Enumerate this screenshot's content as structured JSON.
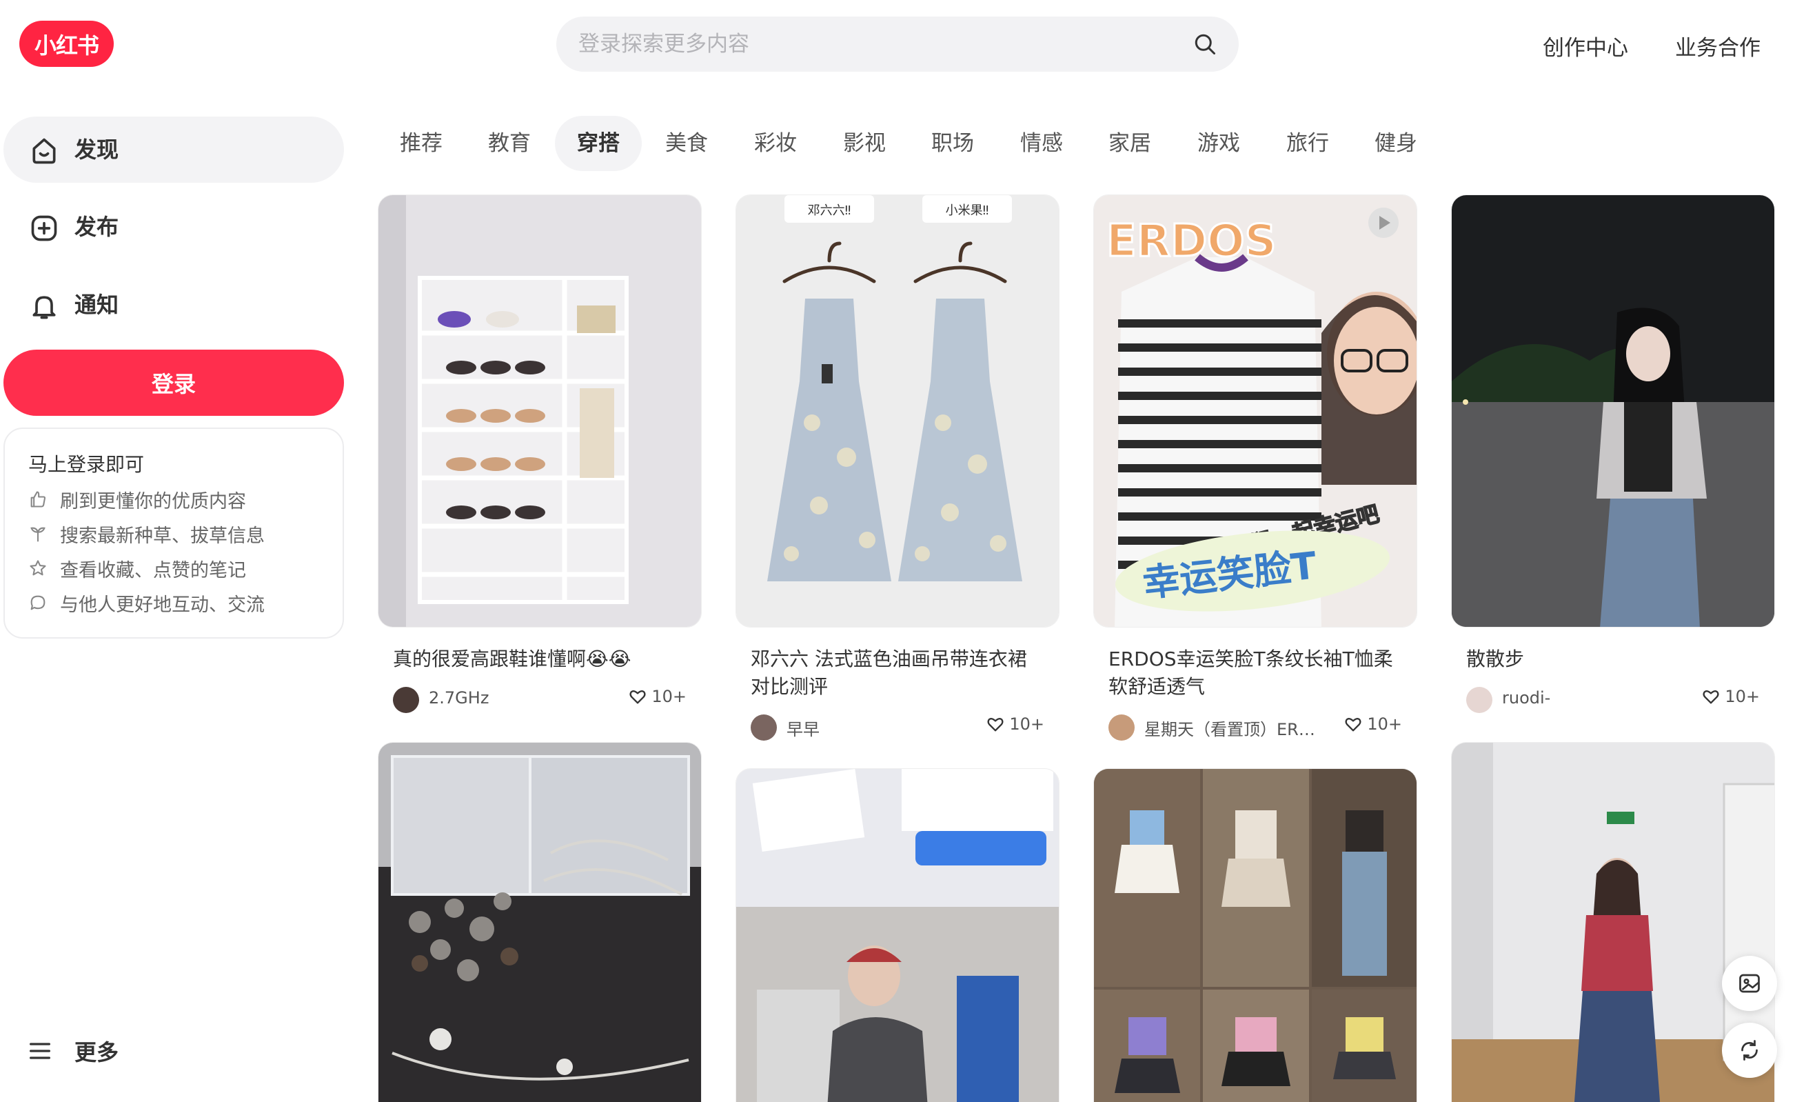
{
  "header": {
    "logo_text": "小红书",
    "search_placeholder": "登录探索更多内容",
    "links": [
      "创作中心",
      "业务合作"
    ]
  },
  "sidebar": {
    "nav": [
      {
        "label": "发现",
        "icon": "discover-icon",
        "active": true
      },
      {
        "label": "发布",
        "icon": "plus-square-icon",
        "active": false
      },
      {
        "label": "通知",
        "icon": "bell-icon",
        "active": false
      }
    ],
    "login_button": "登录",
    "login_card": {
      "title": "马上登录即可",
      "perks": [
        {
          "icon": "thumbs-up-icon",
          "text": "刷到更懂你的优质内容"
        },
        {
          "icon": "grass-icon",
          "text": "搜索最新种草、拔草信息"
        },
        {
          "icon": "star-icon",
          "text": "查看收藏、点赞的笔记"
        },
        {
          "icon": "chat-bubble-icon",
          "text": "与他人更好地互动、交流"
        }
      ]
    },
    "more": "更多"
  },
  "channels": [
    "推荐",
    "教育",
    "穿搭",
    "美食",
    "彩妆",
    "影视",
    "职场",
    "情感",
    "家居",
    "游戏",
    "旅行",
    "健身"
  ],
  "active_channel": "穿搭",
  "feed": [
    {
      "title": "真的很爱高跟鞋谁懂啊😭😭",
      "author": "2.7GHz",
      "likes": "10+"
    },
    {
      "title": "邓六六 法式蓝色油画吊带连衣裙对比测评",
      "author": "早早",
      "likes": "10+",
      "image_labels": [
        "邓六六‼",
        "小米果‼"
      ]
    },
    {
      "title": "ERDOS幸运笑脸T条纹长袖T恤柔软舒适透气",
      "author": "星期天（看置顶）ERD...",
      "likes": "10+",
      "image_labels": [
        "ERDOS",
        "我们一起幸运吧",
        "幸运笑脸T"
      ]
    },
    {
      "title": "散散步",
      "author": "ruodi-",
      "likes": "10+"
    },
    {
      "title": "",
      "author": "",
      "likes": ""
    },
    {
      "title": "",
      "author": "",
      "likes": ""
    },
    {
      "title": "",
      "author": "",
      "likes": ""
    },
    {
      "title": "",
      "author": "",
      "likes": ""
    }
  ],
  "floating_buttons": [
    "image-icon",
    "refresh-icon"
  ],
  "colors": {
    "brand": "#ff2442",
    "login": "#ff2e4d",
    "active_bg": "#f3f3f5"
  }
}
